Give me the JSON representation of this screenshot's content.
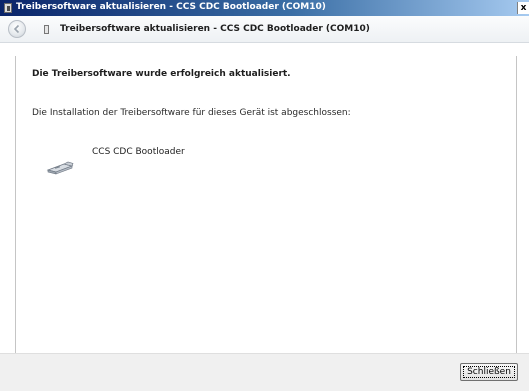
{
  "window": {
    "title": "Treibersoftware aktualisieren - CCS CDC Bootloader (COM10)",
    "close_glyph": "x"
  },
  "header": {
    "title": "Treibersoftware aktualisieren - CCS CDC Bootloader (COM10)"
  },
  "main": {
    "success_message": "Die Treibersoftware wurde erfolgreich aktualisiert.",
    "info_message": "Die Installation der Treibersoftware für dieses Gerät ist abgeschlossen:",
    "device_name": "CCS CDC Bootloader",
    "device_icon": "usb-serial-device-icon"
  },
  "footer": {
    "close_label": "Schließen"
  }
}
